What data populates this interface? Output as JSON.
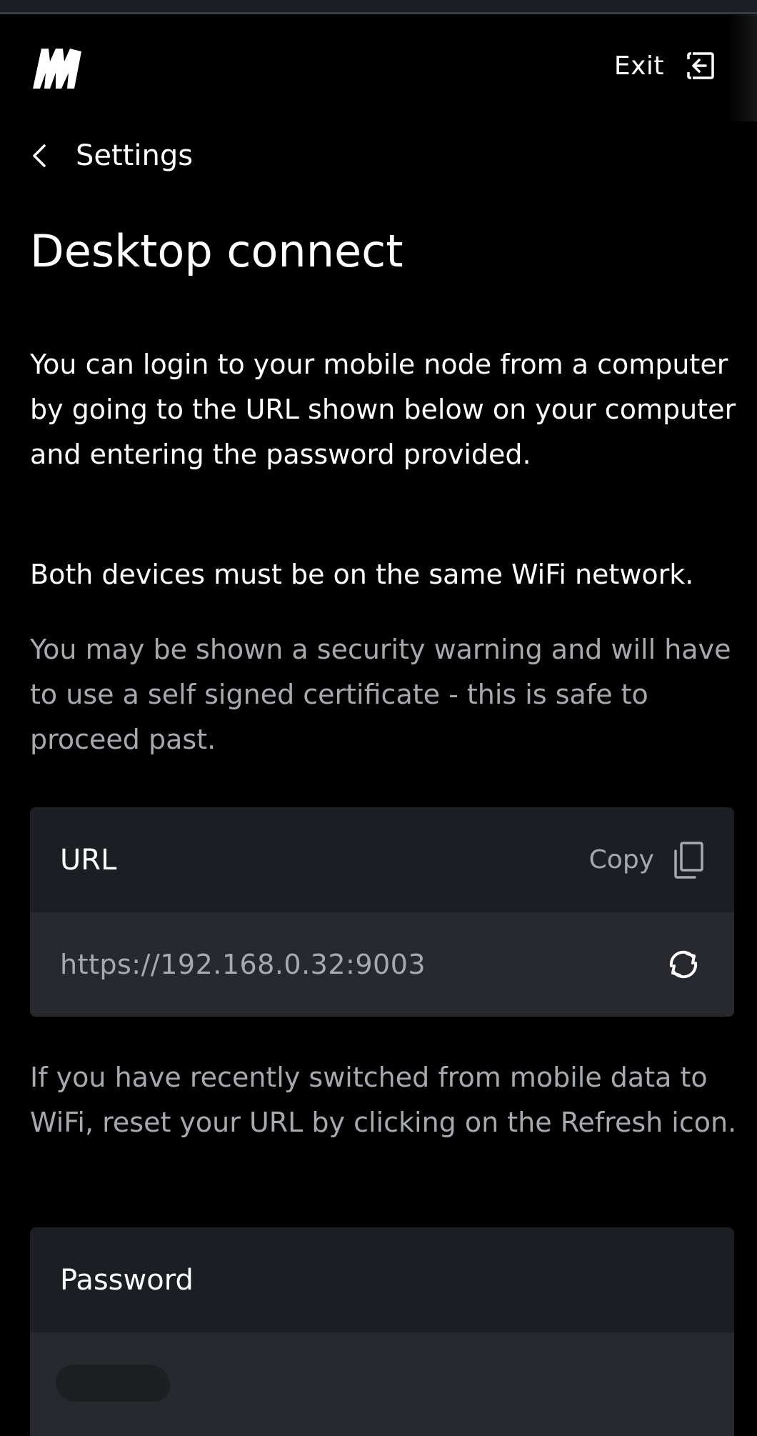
{
  "header": {
    "exit_label": "Exit"
  },
  "nav": {
    "back_label": "Settings"
  },
  "page": {
    "title": "Desktop connect",
    "intro": "You can login to your mobile node from a computer by going to the URL shown below on your computer and entering the password provided.",
    "wifi_note": "Both devices must be on the same WiFi network.",
    "security_note": "You may be shown a security warning and will have to use a self signed certificate - this is safe to proceed past.",
    "reset_note": "If you have recently switched from mobile data to WiFi, reset your URL by clicking on the Refresh icon."
  },
  "url_card": {
    "title": "URL",
    "copy_label": "Copy",
    "value": "https://192.168.0.32:9003"
  },
  "password_card": {
    "title": "Password"
  },
  "icons": {
    "logo": "brand-logo-icon",
    "exit": "exit-icon",
    "back": "chevron-left-icon",
    "copy": "copy-icon",
    "refresh": "refresh-icon"
  },
  "colors": {
    "background": "#000000",
    "card_header": "#1b1e22",
    "card_body": "#27292e",
    "primary_text": "#ffffff",
    "secondary_text": "#a6a9ae"
  }
}
